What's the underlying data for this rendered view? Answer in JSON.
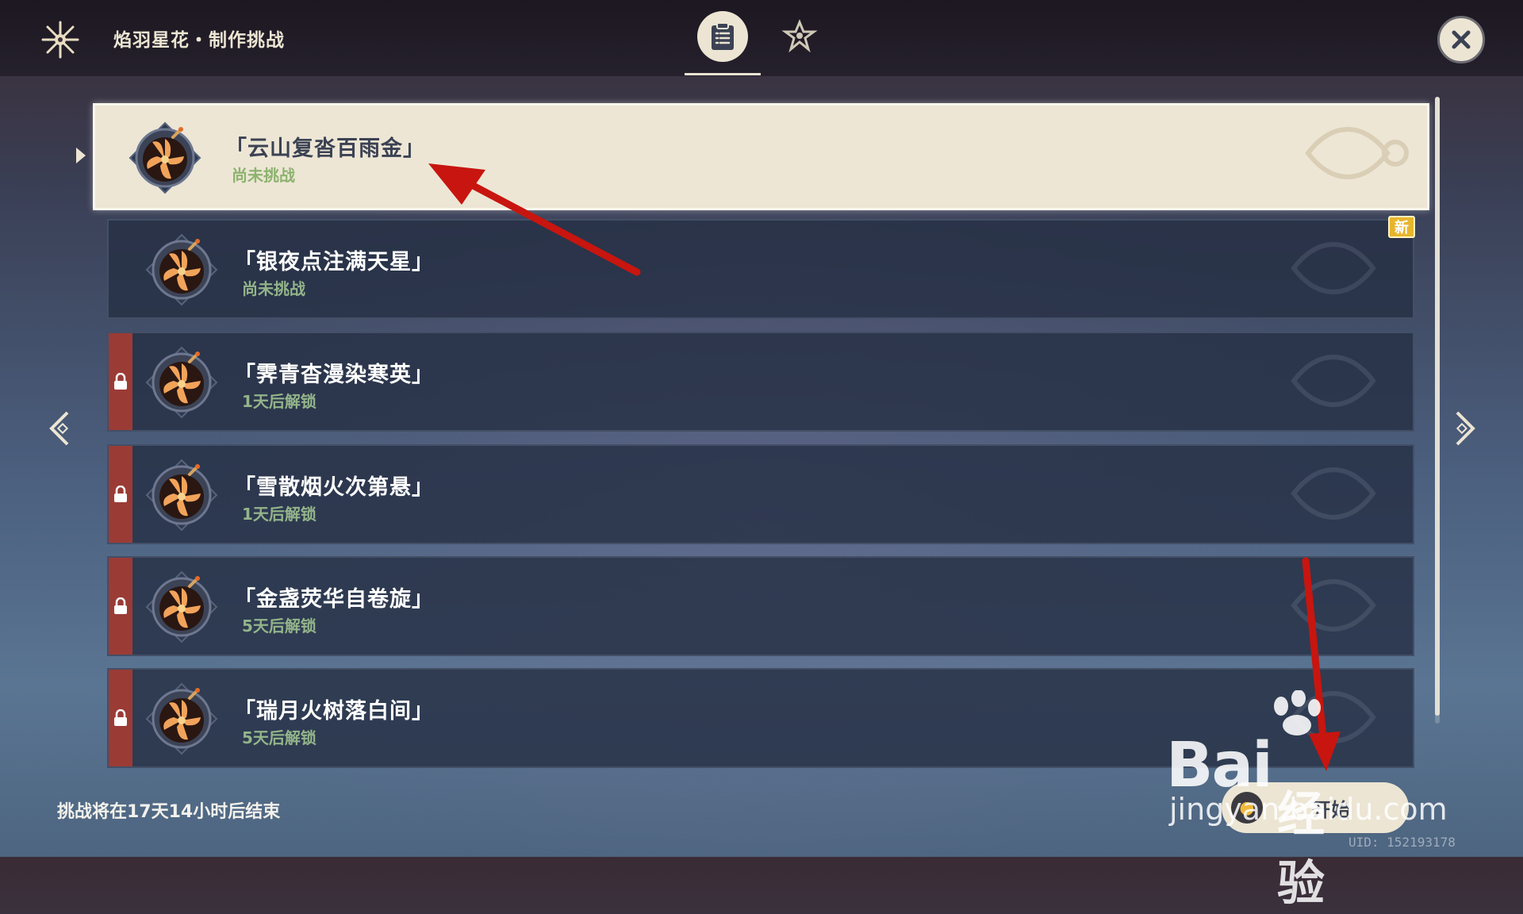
{
  "header": {
    "title": "焰羽星花・制作挑战",
    "logo_icon": "firework-emblem-icon",
    "tabs": [
      {
        "icon": "challenge-list-icon",
        "active": true
      },
      {
        "icon": "firework-rules-icon",
        "active": false
      }
    ],
    "close_icon": "close-icon"
  },
  "challenges": [
    {
      "name": "「云山复沓百雨金」",
      "status": "尚未挑战",
      "locked": false,
      "selected": true,
      "is_new": false
    },
    {
      "name": "「银夜点注满天星」",
      "status": "尚未挑战",
      "locked": false,
      "selected": false,
      "is_new": true
    },
    {
      "name": "「霁青杳漫染寒英」",
      "status": "1天后解锁",
      "locked": true,
      "selected": false,
      "is_new": false
    },
    {
      "name": "「雪散烟火次第悬」",
      "status": "1天后解锁",
      "locked": true,
      "selected": false,
      "is_new": false
    },
    {
      "name": "「金盏荧华自卷旋」",
      "status": "5天后解锁",
      "locked": true,
      "selected": false,
      "is_new": false
    },
    {
      "name": "「瑞月火树落白间」",
      "status": "5天后解锁",
      "locked": true,
      "selected": false,
      "is_new": false
    }
  ],
  "badge_new": "新",
  "footer": {
    "timer_text": "挑战将在17天14小时后结束",
    "start_button_label": "开始",
    "uid_text": "UID: 152193178"
  },
  "watermark": {
    "brand": "Bai",
    "brand_cn": "经验",
    "url": "jingyan.baidu.com"
  },
  "colors": {
    "accent_cream": "#ece5d3",
    "lock_red": "#9b3b36",
    "status_green": "#93b48a",
    "annotation_red": "#c8150f"
  }
}
